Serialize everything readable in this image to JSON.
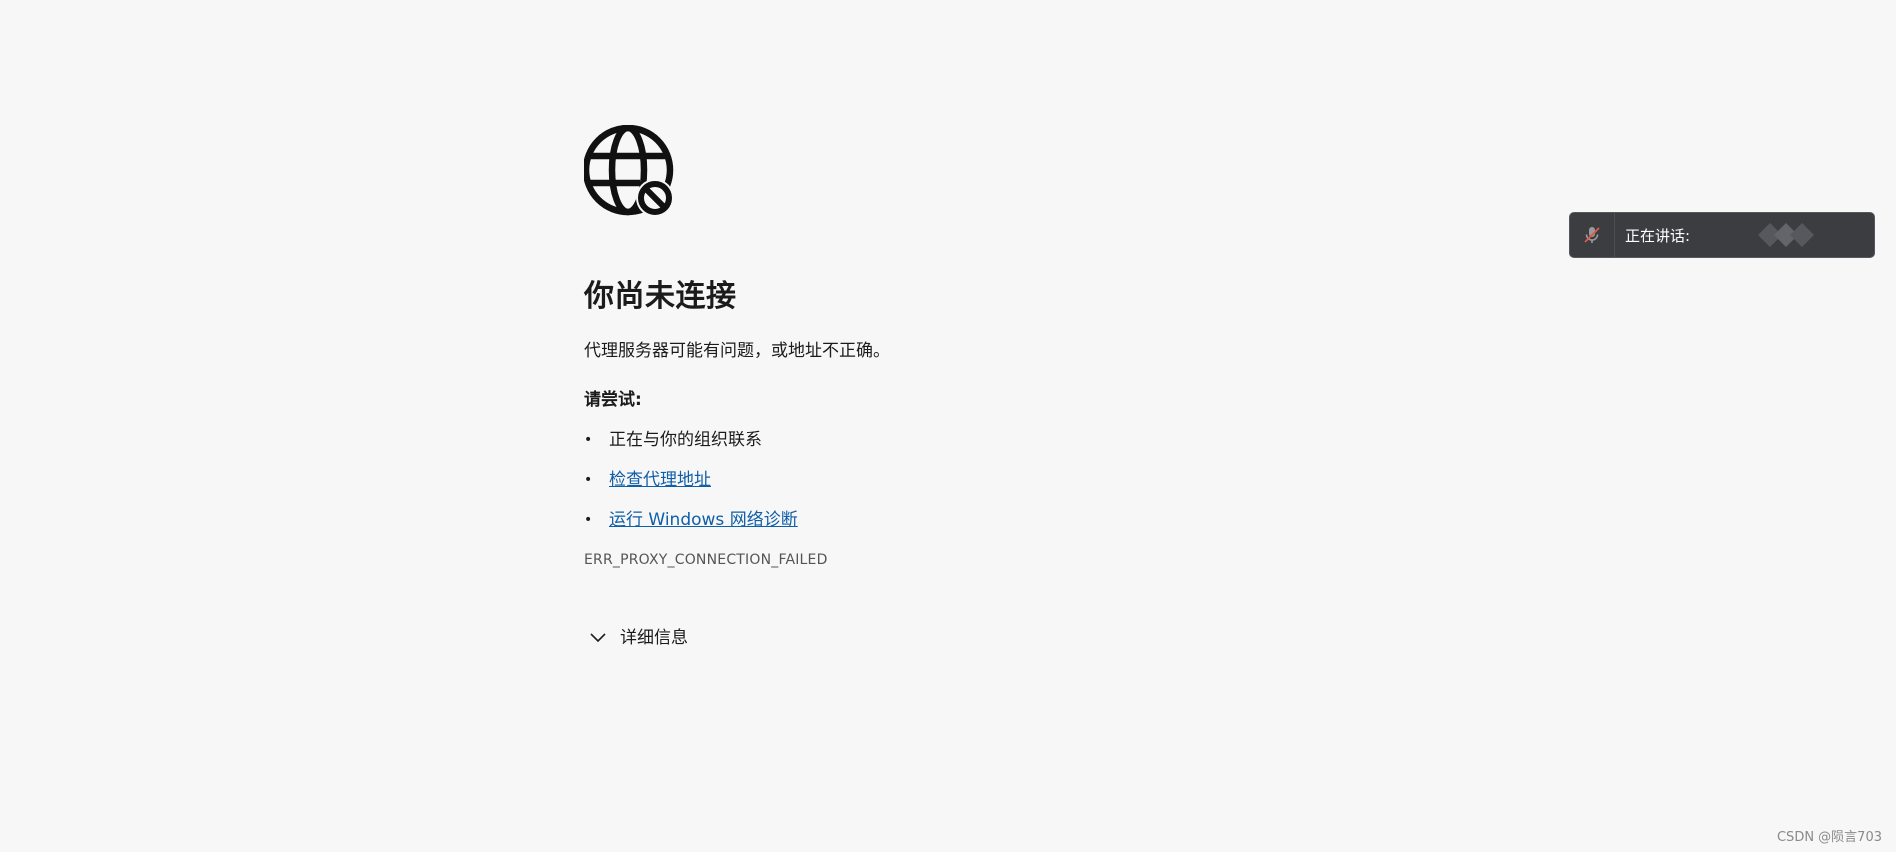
{
  "error_page": {
    "icon": "globe-blocked-icon",
    "title": "你尚未连接",
    "subtitle": "代理服务器可能有问题，或地址不正确。",
    "try_heading": "请尝试:",
    "suggestions": [
      {
        "text": "正在与你的组织联系",
        "is_link": false
      },
      {
        "text": "检查代理地址",
        "is_link": true
      },
      {
        "text": "运行 Windows 网络诊断",
        "is_link": true
      }
    ],
    "bullet": "•",
    "error_code": "ERR_PROXY_CONNECTION_FAILED",
    "details_label": "详细信息",
    "details_icon": "chevron-down-icon",
    "link_color": "#0f5ea8"
  },
  "speaking_toast": {
    "mic_icon": "mic-muted-icon",
    "label": "正在讲话:",
    "background": "#3b3d40"
  },
  "watermark": "CSDN @陨言703"
}
